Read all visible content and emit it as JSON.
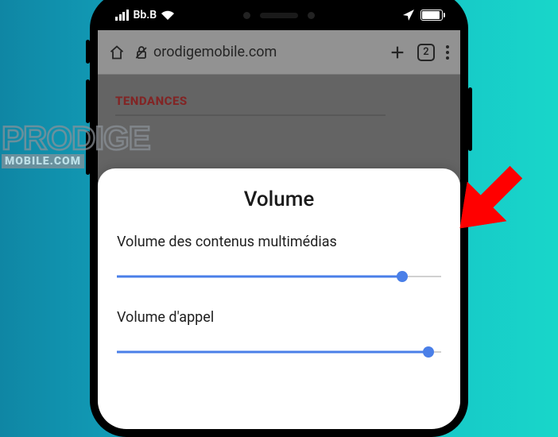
{
  "status_bar": {
    "carrier": "Bb.B"
  },
  "browser": {
    "url_visible": "orodigemobile.com",
    "tab_count": "2"
  },
  "page": {
    "section_header": "TENDANCES"
  },
  "sheet": {
    "title": "Volume",
    "sliders": [
      {
        "label": "Volume des contenus multimédias",
        "value": 88
      },
      {
        "label": "Volume d'appel",
        "value": 96
      }
    ]
  },
  "watermark": {
    "line1": "PRODIGE",
    "line2": "MOBILE.COM"
  }
}
